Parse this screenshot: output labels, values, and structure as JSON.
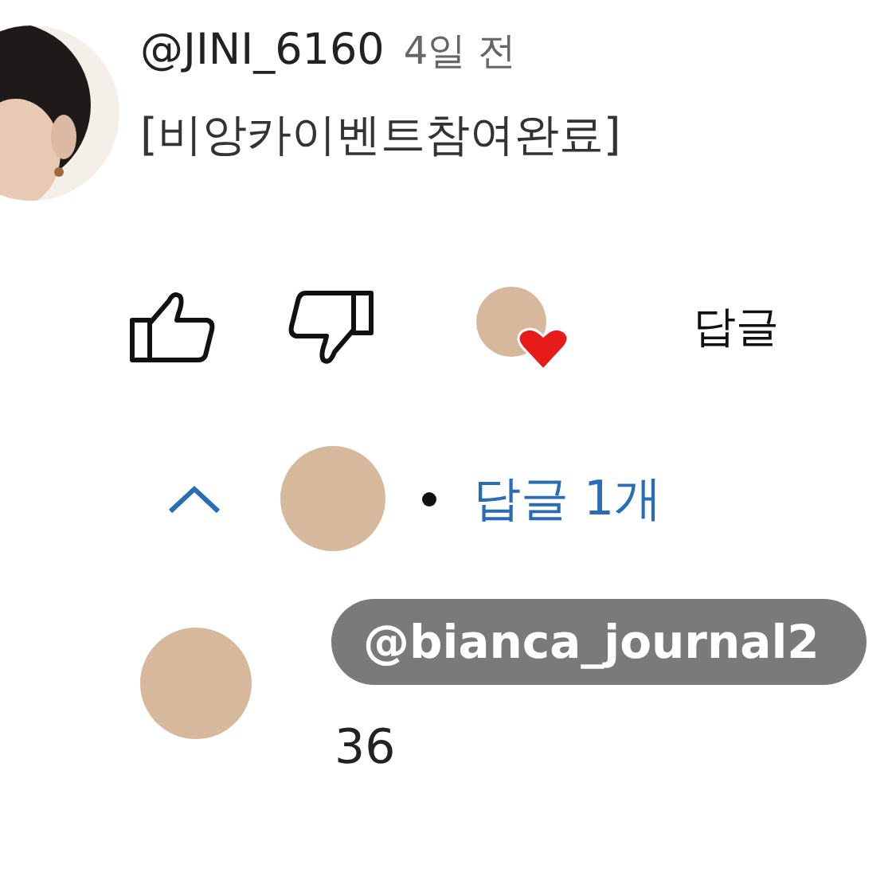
{
  "comment": {
    "author": "@JINI_6160",
    "time": "4일 전",
    "text": "[비앙카이벤트참여완료]"
  },
  "actions": {
    "reply_label": "답글",
    "creator_heart": true
  },
  "replies_toggle": {
    "expanded": true,
    "label": "답글 1개"
  },
  "reply": {
    "mention": "@bianca_journal2",
    "text": "36"
  }
}
